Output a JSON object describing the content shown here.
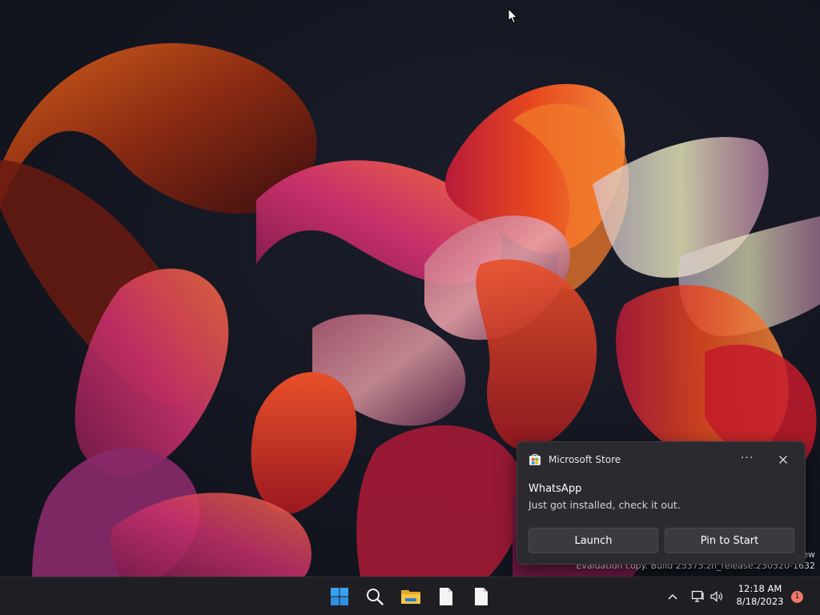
{
  "watermark": {
    "line1": "ew",
    "line2": "Evaluation copy. Build 25375.zn_release.230520-1632"
  },
  "toast": {
    "app_name": "Microsoft Store",
    "more_label": "···",
    "title": "WhatsApp",
    "body": "Just got installed, check it out.",
    "launch_label": "Launch",
    "pin_label": "Pin to Start"
  },
  "taskbar": {
    "icons": [
      "windows-start-icon",
      "search-icon",
      "file-explorer-icon",
      "document-icon",
      "document-icon"
    ],
    "tray_icons": [
      "chevron-up-icon",
      "network-icon",
      "volume-icon"
    ]
  },
  "clock": {
    "time": "12:18 AM",
    "date": "8/18/2023"
  },
  "notification_badge": {
    "count": "1"
  },
  "colors": {
    "taskbar_bg": "#1f1f23",
    "toast_bg": "#2b2b2f",
    "button_bg": "#3a3a3f",
    "badge": "#f0786a",
    "start_blue": "#3aa0f2"
  }
}
